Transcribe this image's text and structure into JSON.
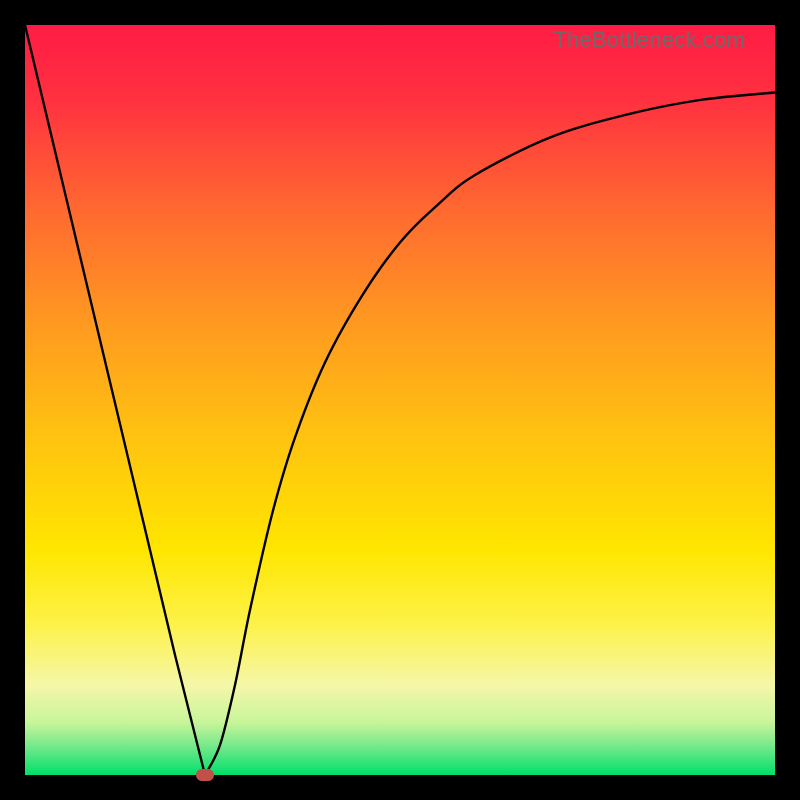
{
  "watermark": {
    "text": "TheBottleneck.com"
  },
  "chart_data": {
    "type": "line",
    "title": "",
    "xlabel": "",
    "ylabel": "",
    "xlim": [
      0,
      100
    ],
    "ylim": [
      0,
      100
    ],
    "grid": false,
    "legend": false,
    "series": [
      {
        "name": "bottleneck-curve",
        "x": [
          0,
          5,
          10,
          15,
          20,
          24,
          26,
          28,
          30,
          33,
          36,
          40,
          45,
          50,
          55,
          60,
          70,
          80,
          90,
          100
        ],
        "y": [
          100,
          79,
          58,
          37,
          16,
          0,
          4,
          12,
          22,
          35,
          45,
          55,
          64,
          71,
          76,
          80,
          85,
          88,
          90,
          91
        ]
      }
    ],
    "annotations": [
      {
        "name": "min-marker",
        "x": 24,
        "y": 0,
        "color": "#c05048"
      }
    ],
    "background_gradient": {
      "stops": [
        {
          "offset": 0.0,
          "color": "#ff1c44"
        },
        {
          "offset": 0.1,
          "color": "#ff3140"
        },
        {
          "offset": 0.25,
          "color": "#ff6a30"
        },
        {
          "offset": 0.4,
          "color": "#ff9a20"
        },
        {
          "offset": 0.55,
          "color": "#ffc310"
        },
        {
          "offset": 0.7,
          "color": "#ffe600"
        },
        {
          "offset": 0.8,
          "color": "#fdf24a"
        },
        {
          "offset": 0.88,
          "color": "#f5f7a8"
        },
        {
          "offset": 0.93,
          "color": "#c8f59a"
        },
        {
          "offset": 0.965,
          "color": "#6be888"
        },
        {
          "offset": 1.0,
          "color": "#00e06a"
        }
      ]
    }
  },
  "marker_style": {
    "fill": "#c05048"
  }
}
